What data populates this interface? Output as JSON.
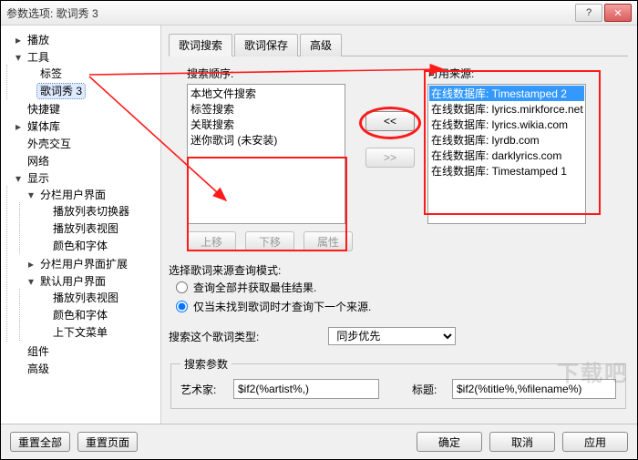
{
  "window": {
    "title": "参数选项: 歌词秀 3"
  },
  "tree": {
    "items": [
      {
        "label": "播放",
        "exp": "▸"
      },
      {
        "label": "工具",
        "exp": "▾",
        "children": [
          {
            "label": "标签"
          },
          {
            "label": "歌词秀 3",
            "selected": true
          }
        ]
      },
      {
        "label": "快捷键"
      },
      {
        "label": "媒体库",
        "exp": "▸"
      },
      {
        "label": "外壳交互"
      },
      {
        "label": "网络"
      },
      {
        "label": "显示",
        "exp": "▾",
        "children": [
          {
            "label": "分栏用户界面",
            "exp": "▾",
            "children": [
              {
                "label": "播放列表切换器"
              },
              {
                "label": "播放列表视图"
              },
              {
                "label": "颜色和字体"
              }
            ]
          },
          {
            "label": "分栏用户界面扩展",
            "exp": "▸"
          },
          {
            "label": "默认用户界面",
            "exp": "▾",
            "children": [
              {
                "label": "播放列表视图"
              },
              {
                "label": "颜色和字体"
              },
              {
                "label": "上下文菜单"
              }
            ]
          }
        ]
      },
      {
        "label": "组件"
      },
      {
        "label": "高级"
      }
    ]
  },
  "tabs": {
    "items": [
      "歌词搜索",
      "歌词保存",
      "高级"
    ],
    "active": 0
  },
  "search_order": {
    "label": "搜索顺序:",
    "items": [
      "本地文件搜索",
      "标签搜索",
      "关联搜索",
      "迷你歌词 (未安装)"
    ]
  },
  "available": {
    "label": "可用来源:",
    "items": [
      "在线数据库: Timestamped 2",
      "在线数据库: lyrics.mirkforce.net",
      "在线数据库: lyrics.wikia.com",
      "在线数据库: lyrdb.com",
      "在线数据库: darklyrics.com",
      "在线数据库: Timestamped 1"
    ],
    "selected_index": 0
  },
  "mid": {
    "left": "<<",
    "right": ">>"
  },
  "order_btns": {
    "up": "上移",
    "down": "下移",
    "props": "属性"
  },
  "mode": {
    "label": "选择歌词来源查询模式:",
    "opt_all": "查询全部并获取最佳结果.",
    "opt_until": "仅当未找到歌词时才查询下一个来源."
  },
  "type_row": {
    "label": "搜索这个歌词类型:",
    "select_value": "同步优先"
  },
  "params": {
    "legend": "搜索参数",
    "artist_label": "艺术家:",
    "artist_value": "$if2(%artist%,)",
    "title_label": "标题:",
    "title_value": "$if2(%title%,%filename%)"
  },
  "footer": {
    "reset_all": "重置全部",
    "reset_page": "重置页面",
    "ok": "确定",
    "cancel": "取消",
    "apply": "应用"
  },
  "watermark": "下载吧"
}
